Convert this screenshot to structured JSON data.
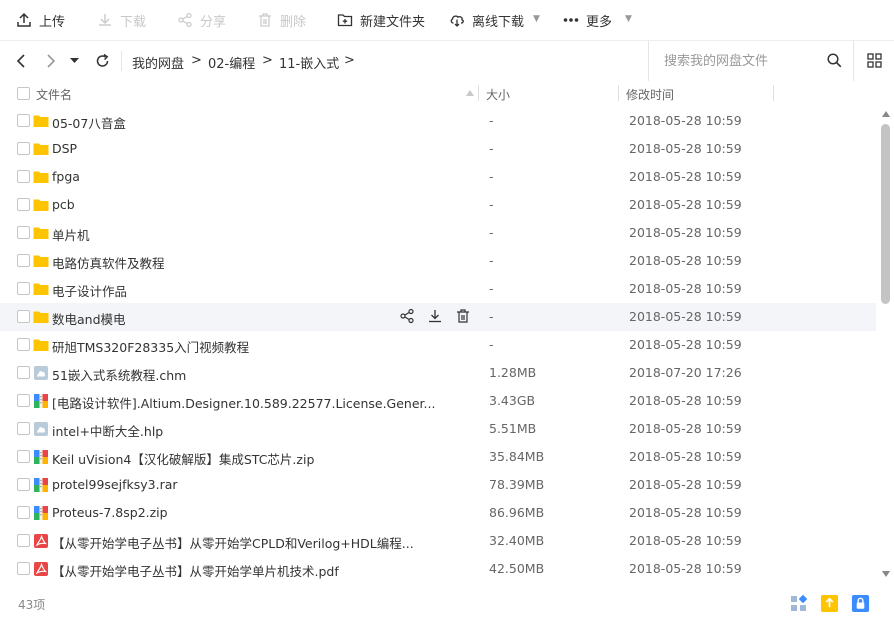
{
  "toolbar": {
    "upload": "上传",
    "download": "下载",
    "share": "分享",
    "delete": "删除",
    "new_folder": "新建文件夹",
    "offline_download": "离线下载",
    "more": "更多"
  },
  "nav": {
    "breadcrumbs": [
      "我的网盘",
      "02-编程",
      "11-嵌入式"
    ],
    "separator": ">",
    "search_placeholder": "搜索我的网盘文件"
  },
  "columns": {
    "name": "文件名",
    "size": "大小",
    "modified": "修改时间"
  },
  "files": [
    {
      "name": "05-07八音盒",
      "size": "-",
      "date": "2018-05-28 10:59",
      "type": "folder"
    },
    {
      "name": "DSP",
      "size": "-",
      "date": "2018-05-28 10:59",
      "type": "folder"
    },
    {
      "name": "fpga",
      "size": "-",
      "date": "2018-05-28 10:59",
      "type": "folder"
    },
    {
      "name": "pcb",
      "size": "-",
      "date": "2018-05-28 10:59",
      "type": "folder"
    },
    {
      "name": "单片机",
      "size": "-",
      "date": "2018-05-28 10:59",
      "type": "folder"
    },
    {
      "name": "电路仿真软件及教程",
      "size": "-",
      "date": "2018-05-28 10:59",
      "type": "folder"
    },
    {
      "name": "电子设计作品",
      "size": "-",
      "date": "2018-05-28 10:59",
      "type": "folder"
    },
    {
      "name": "数电and模电",
      "size": "-",
      "date": "2018-05-28 10:59",
      "type": "folder"
    },
    {
      "name": "研旭TMS320F28335入门视频教程",
      "size": "-",
      "date": "2018-05-28 10:59",
      "type": "folder"
    },
    {
      "name": "51嵌入式系统教程.chm",
      "size": "1.28MB",
      "date": "2018-07-20 17:26",
      "type": "doc"
    },
    {
      "name": "[电路设计软件].Altium.Designer.10.589.22577.License.Gener...",
      "size": "3.43GB",
      "date": "2018-05-28 10:59",
      "type": "archive"
    },
    {
      "name": "intel+中断大全.hlp",
      "size": "5.51MB",
      "date": "2018-05-28 10:59",
      "type": "doc"
    },
    {
      "name": "Keil uVision4【汉化破解版】集成STC芯片.zip",
      "size": "35.84MB",
      "date": "2018-05-28 10:59",
      "type": "archive"
    },
    {
      "name": "protel99sejfksy3.rar",
      "size": "78.39MB",
      "date": "2018-05-28 10:59",
      "type": "archive"
    },
    {
      "name": "Proteus-7.8sp2.zip",
      "size": "86.96MB",
      "date": "2018-05-28 10:59",
      "type": "archive"
    },
    {
      "name": "【从零开始学电子丛书】从零开始学CPLD和Verilog+HDL编程...",
      "size": "32.40MB",
      "date": "2018-05-28 10:59",
      "type": "pdf"
    },
    {
      "name": "【从零开始学电子丛书】从零开始学单片机技术.pdf",
      "size": "42.50MB",
      "date": "2018-05-28 10:59",
      "type": "pdf"
    }
  ],
  "hover_row_index": 7,
  "footer": {
    "count": "43项"
  },
  "colors": {
    "folder": "#ffc400",
    "doc": "#b9cad9",
    "pdf": "#e84646",
    "accent": "#3b8cff",
    "hover_bg": "#f3f5f8"
  }
}
